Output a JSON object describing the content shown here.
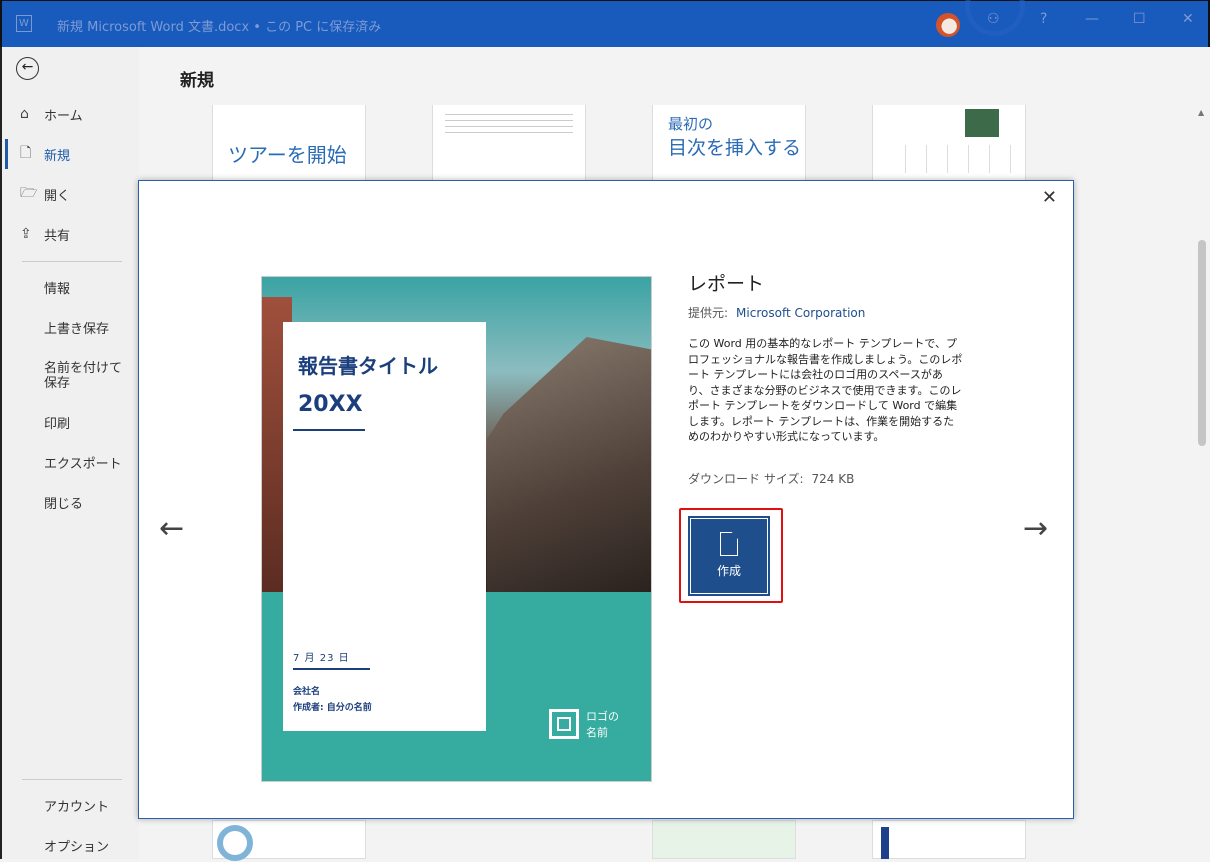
{
  "titlebar": {
    "title": "新規 Microsoft Word 文書.docx • この PC に保存済み",
    "help": "?",
    "minimize": "—",
    "maximize": "☐",
    "close": "✕",
    "app_icon": "W"
  },
  "sidebar": {
    "back": "←",
    "items": [
      {
        "label": "ホーム",
        "icon": "home-icon"
      },
      {
        "label": "新規",
        "icon": "new-doc-icon"
      },
      {
        "label": "開く",
        "icon": "folder-icon"
      },
      {
        "label": "共有",
        "icon": "share-icon"
      }
    ],
    "plain": [
      "情報",
      "上書き保存",
      "名前を付けて保存",
      "印刷",
      "エクスポート",
      "閉じる"
    ],
    "bottom": [
      "アカウント",
      "オプション"
    ]
  },
  "main": {
    "title": "新規",
    "thumbs": {
      "tour": "ツアーを開始",
      "toc_1": "最初の",
      "toc_2": "目次を挿入する"
    }
  },
  "modal": {
    "close": "✕",
    "prev": "←",
    "next": "→",
    "preview": {
      "title": "報告書タイトル",
      "year": "20XX",
      "date": "7 月 23 日",
      "company": "会社名",
      "author": "作成者: 自分の名前",
      "logo_1": "ロゴの",
      "logo_2": "名前"
    },
    "name": "レポート",
    "provider_label": "提供元:",
    "provider": "Microsoft Corporation",
    "description": "この Word 用の基本的なレポート テンプレートで、プロフェッショナルな報告書を作成しましょう。このレポート テンプレートには会社のロゴ用のスペースがあり、さまざまな分野のビジネスで使用できます。このレポート テンプレートをダウンロードして Word で編集します。レポート テンプレートは、作業を開始するためのわかりやすい形式になっています。",
    "size_label": "ダウンロード サイズ:",
    "size": "724 KB",
    "create": "作成"
  }
}
